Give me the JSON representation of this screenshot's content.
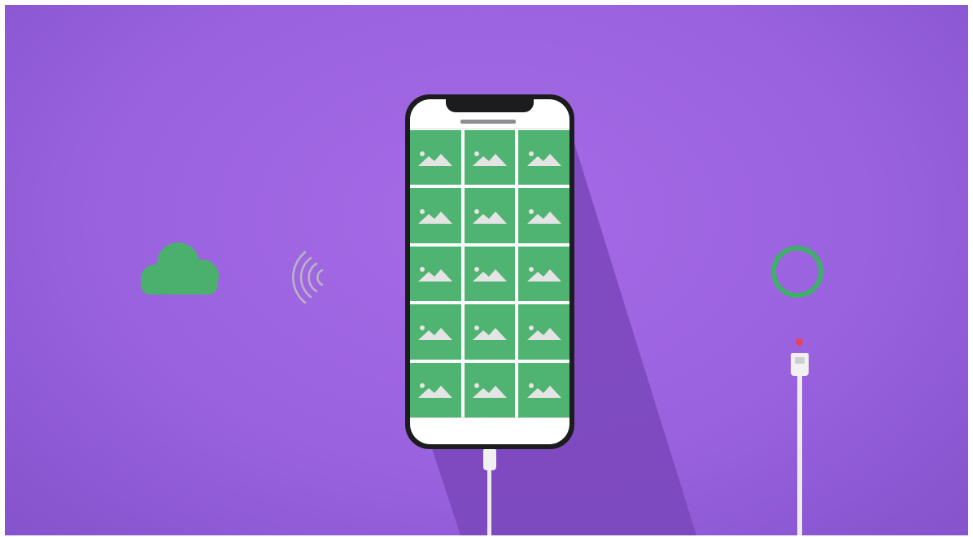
{
  "colors": {
    "bg_main": "#9a62df",
    "bg_light": "#a66ae6",
    "bg_dark": "#8553cc",
    "tile": "#4fb372",
    "ring": "#3fb06a",
    "cloud": "#4bb06d",
    "led": "#e54357",
    "shadow": "#7a46bb"
  },
  "icons": {
    "cloud": "cloud-icon",
    "wifi": "wireless-signal-icon",
    "ring": "progress-ring-icon",
    "photo": "image-placeholder-icon",
    "plug": "usb-cable-icon"
  },
  "phone": {
    "grid_rows": 5,
    "grid_cols": 3
  }
}
